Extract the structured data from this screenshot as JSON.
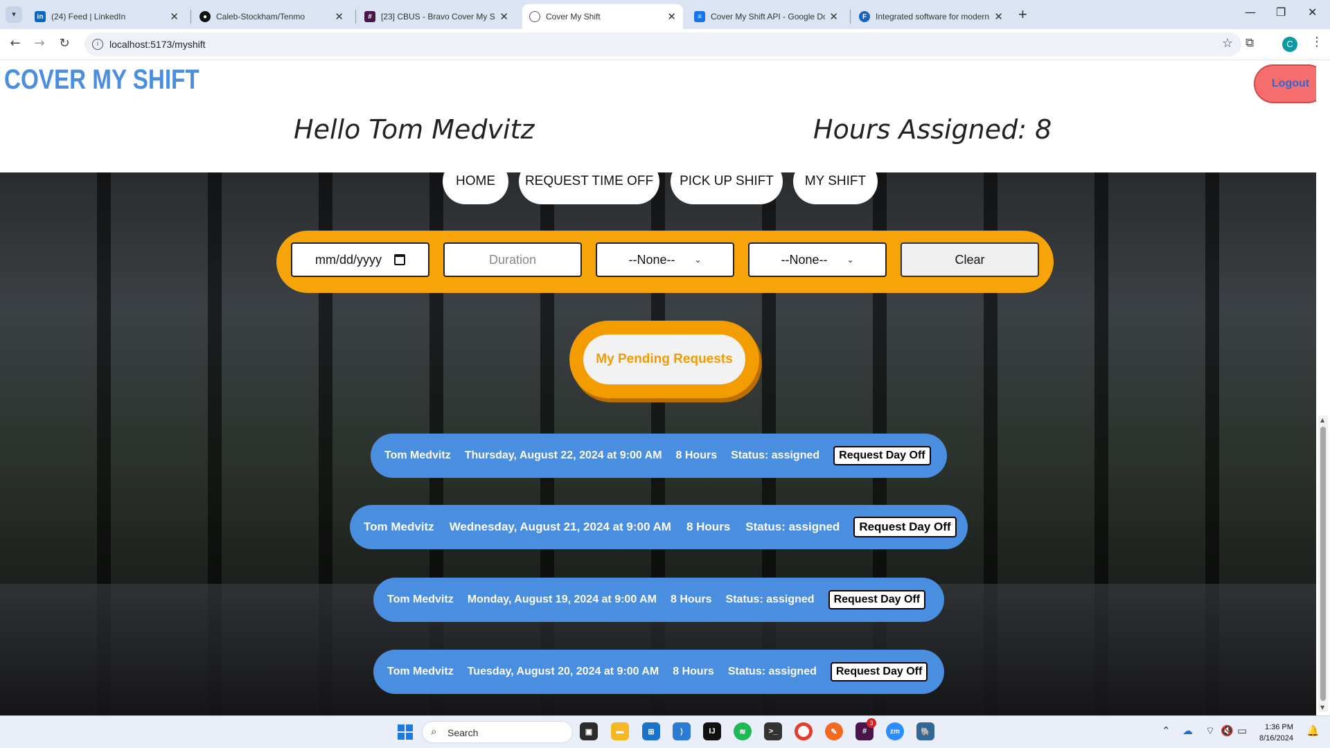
{
  "browser": {
    "tabs": [
      {
        "title": "(24) Feed | LinkedIn",
        "icon": "linkedin-icon",
        "color": "#0a66c2",
        "active": false
      },
      {
        "title": "Caleb-Stockham/Tenmo",
        "icon": "github-icon",
        "color": "#111111",
        "active": false
      },
      {
        "title": "[23] CBUS - Bravo Cover My Sh",
        "icon": "slack-icon",
        "color": "#4a154b",
        "active": false
      },
      {
        "title": "Cover My Shift",
        "icon": "globe-icon",
        "color": "#555555",
        "active": true
      },
      {
        "title": "Cover My Shift API - Google Do",
        "icon": "docs-icon",
        "color": "#1a73e8",
        "active": false
      },
      {
        "title": "Integrated software for modern",
        "icon": "f-icon",
        "color": "#1565c0",
        "active": false
      }
    ],
    "url": "localhost:5173/myshift",
    "profile_initial": "C"
  },
  "app": {
    "logo": "COVER MY SHIFT",
    "logout_label": "Logout",
    "greeting": "Hello Tom Medvitz",
    "hours_label": "Hours Assigned:",
    "hours_value": "8",
    "nav": [
      "HOME",
      "REQUEST TIME OFF",
      "PICK UP SHIFT",
      "MY SHIFT"
    ],
    "filters": {
      "date_placeholder": "mm/dd/yyyy",
      "duration_placeholder": "Duration",
      "select1_value": "--None--",
      "select2_value": "--None--",
      "clear_label": "Clear"
    },
    "pending_label": "My Pending Requests",
    "shifts": [
      {
        "name": "Tom Medvitz",
        "date": "Thursday, August 22, 2024 at 9:00 AM",
        "duration": "8 Hours",
        "status": "Status: assigned",
        "action": "Request Day Off"
      },
      {
        "name": "Tom Medvitz",
        "date": "Wednesday, August 21, 2024 at 9:00 AM",
        "duration": "8 Hours",
        "status": "Status: assigned",
        "action": "Request Day Off"
      },
      {
        "name": "Tom Medvitz",
        "date": "Monday, August 19, 2024 at 9:00 AM",
        "duration": "8 Hours",
        "status": "Status: assigned",
        "action": "Request Day Off"
      },
      {
        "name": "Tom Medvitz",
        "date": "Tuesday, August 20, 2024 at 9:00 AM",
        "duration": "8 Hours",
        "status": "Status: assigned",
        "action": "Request Day Off"
      }
    ]
  },
  "taskbar": {
    "search_label": "Search",
    "slack_badge": "3",
    "time": "1:36 PM",
    "date": "8/16/2024"
  }
}
